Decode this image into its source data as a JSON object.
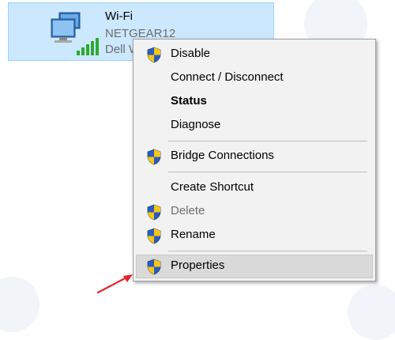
{
  "adapter": {
    "name": "Wi-Fi",
    "network": "NETGEAR12",
    "device": "Dell W"
  },
  "context_menu": {
    "items": [
      {
        "label": "Disable",
        "icon": "uac-shield-icon",
        "style": "normal"
      },
      {
        "label": "Connect / Disconnect",
        "icon": "",
        "style": "normal"
      },
      {
        "label": "Status",
        "icon": "",
        "style": "bold"
      },
      {
        "label": "Diagnose",
        "icon": "",
        "style": "normal"
      },
      {
        "label": "Bridge Connections",
        "icon": "uac-shield-icon",
        "style": "normal"
      },
      {
        "label": "Create Shortcut",
        "icon": "",
        "style": "normal"
      },
      {
        "label": "Delete",
        "icon": "uac-shield-icon",
        "style": "disabled"
      },
      {
        "label": "Rename",
        "icon": "uac-shield-icon",
        "style": "normal"
      },
      {
        "label": "Properties",
        "icon": "uac-shield-icon",
        "style": "highlighted"
      }
    ]
  },
  "colors": {
    "selection_fill": "#cce8ff",
    "menu_background": "#f2f2f2",
    "highlight": "#dadada",
    "arrow": "#e0262a"
  }
}
